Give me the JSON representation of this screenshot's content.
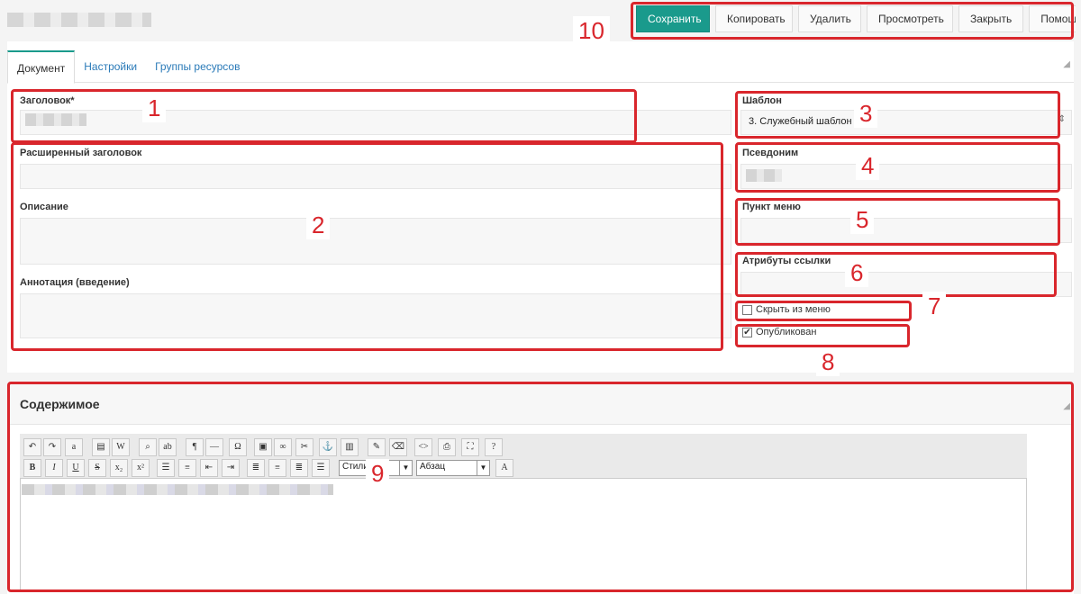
{
  "toolbar": {
    "save": "Сохранить",
    "copy": "Копировать",
    "delete": "Удалить",
    "preview": "Просмотреть",
    "close": "Закрыть",
    "help": "Помощь"
  },
  "tabs": {
    "document": "Документ",
    "settings": "Настройки",
    "resource_groups": "Группы ресурсов"
  },
  "fields": {
    "title_label": "Заголовок*",
    "long_title_label": "Расширенный заголовок",
    "description_label": "Описание",
    "summary_label": "Аннотация (введение)",
    "template_label": "Шаблон",
    "template_value": "3. Служебный шаблон",
    "alias_label": "Псевдоним",
    "menu_item_label": "Пункт меню",
    "link_attrs_label": "Атрибуты ссылки",
    "hide_menu_label": "Скрыть из меню",
    "published_label": "Опубликован",
    "hide_menu_checked": false,
    "published_checked": true
  },
  "content": {
    "title": "Содержимое",
    "style_select": "Стили",
    "format_select": "Абзац"
  },
  "annotations": [
    "1",
    "2",
    "3",
    "4",
    "5",
    "6",
    "7",
    "8",
    "9",
    "10"
  ],
  "colors": {
    "primary": "#1a9a8c",
    "annotation": "#d9262c"
  }
}
